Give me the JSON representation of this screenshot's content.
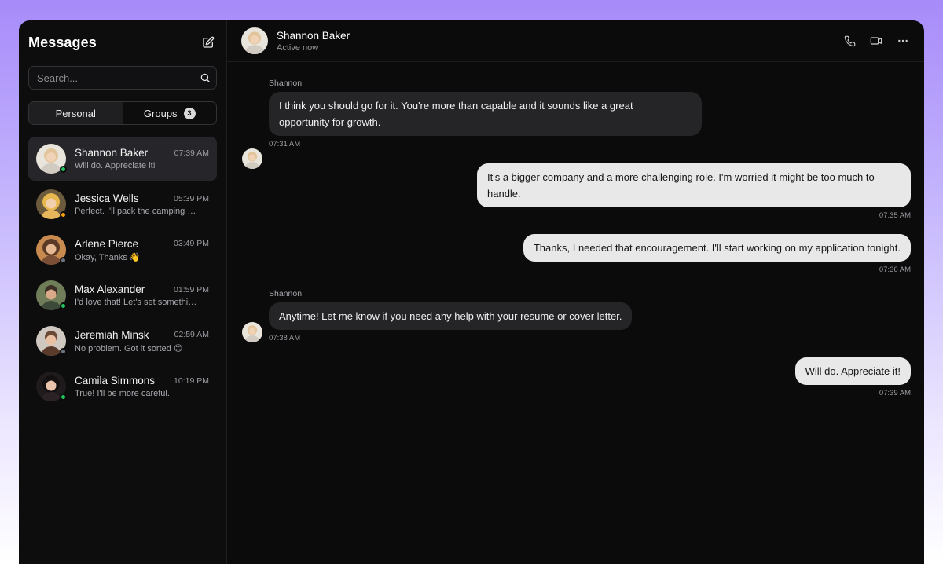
{
  "sidebar": {
    "title": "Messages",
    "search_placeholder": "Search...",
    "tabs": [
      {
        "label": "Personal"
      },
      {
        "label": "Groups",
        "badge": "3"
      }
    ],
    "conversations": [
      {
        "name": "Shannon Baker",
        "time": "07:39 AM",
        "preview": "Will do. Appreciate it!",
        "status_color": "#22c55e",
        "avatar_color": "#d8cfc3"
      },
      {
        "name": "Jessica Wells",
        "time": "05:39 PM",
        "preview": "Perfect. I'll pack the camping …",
        "status_color": "#f59e0b",
        "avatar_color": "#e4b24a"
      },
      {
        "name": "Arlene Pierce",
        "time": "03:49 PM",
        "preview": "Okay, Thanks 👋",
        "status_color": "#6b7280",
        "avatar_color": "#b07a4f"
      },
      {
        "name": "Max Alexander",
        "time": "01:59 PM",
        "preview": "I'd love that! Let's set somethi…",
        "status_color": "#22c55e",
        "avatar_color": "#7a8a5a"
      },
      {
        "name": "Jeremiah Minsk",
        "time": "02:59 AM",
        "preview": "No problem. Got it sorted 😊",
        "status_color": "#6b7280",
        "avatar_color": "#c9c2bb"
      },
      {
        "name": "Camila Simmons",
        "time": "10:19 PM",
        "preview": "True! I'll be more careful.",
        "status_color": "#22c55e",
        "avatar_color": "#3a2b2b"
      }
    ]
  },
  "chat": {
    "contact_name": "Shannon Baker",
    "contact_status": "Active now",
    "messages": [
      {
        "direction": "in",
        "sender": "Shannon",
        "text_line1": "I think you should go for it. You're more than capable and it sounds like a great",
        "text_line2": "opportunity for growth.",
        "time": "07:31 AM"
      },
      {
        "direction": "out",
        "text_line1": "It's a bigger company and a more challenging role. I'm worried it might be too much to",
        "text_line2": "handle.",
        "time": "07:35 AM"
      },
      {
        "direction": "out",
        "text_line1": "Thanks, I needed that encouragement. I'll start working on my application tonight.",
        "time": "07:36 AM"
      },
      {
        "direction": "in",
        "sender": "Shannon",
        "text_line1": "Anytime! Let me know if you need any help with your resume or cover letter.",
        "time": "07:38 AM"
      },
      {
        "direction": "out",
        "text_line1": "Will do. Appreciate it!",
        "time": "07:39 AM"
      }
    ]
  },
  "icons": {
    "compose": "compose-icon",
    "search": "search-icon",
    "phone": "phone-icon",
    "video": "video-icon",
    "more": "more-icon"
  },
  "colors": {
    "background_top": "#a78bfa",
    "window_bg": "#0b0b0c",
    "bubble_in": "#252528",
    "bubble_out": "#e8e8e8",
    "online": "#22c55e"
  }
}
